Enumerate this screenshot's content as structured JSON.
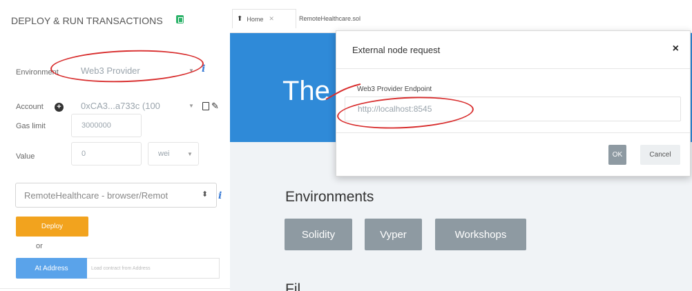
{
  "left_panel": {
    "title": "DEPLOY & RUN TRANSACTIONS",
    "environment": {
      "label": "Environment",
      "value": "Web3 Provider"
    },
    "account": {
      "label": "Account",
      "value": "0xCA3...a733c (100"
    },
    "gas_limit": {
      "label": "Gas limit",
      "value": "3000000"
    },
    "value": {
      "label": "Value",
      "amount": "0",
      "unit": "wei"
    },
    "contract": {
      "value": "RemoteHealthcare - browser/Remot"
    },
    "deploy_label": "Deploy",
    "or_label": "or",
    "at_address_label": "At Address",
    "at_address_placeholder": "Load contract from Address"
  },
  "tabs": [
    {
      "label": "Home"
    },
    {
      "label": "RemoteHealthcare.sol"
    }
  ],
  "hero": {
    "title": "The"
  },
  "environments": {
    "title": "Environments",
    "buttons": [
      "Solidity",
      "Vyper",
      "Workshops"
    ]
  },
  "next_section_title": "Fil",
  "modal": {
    "title": "External node request",
    "close": "×",
    "endpoint_label": "Web3 Provider Endpoint",
    "endpoint_value": "http://localhost:8545",
    "ok_label": "OK",
    "cancel_label": "Cancel"
  },
  "colors": {
    "deploy": "#f2a31e",
    "at_address": "#5aa3ea",
    "hero": "#2f8ad8",
    "annotation": "#d82d2d"
  }
}
